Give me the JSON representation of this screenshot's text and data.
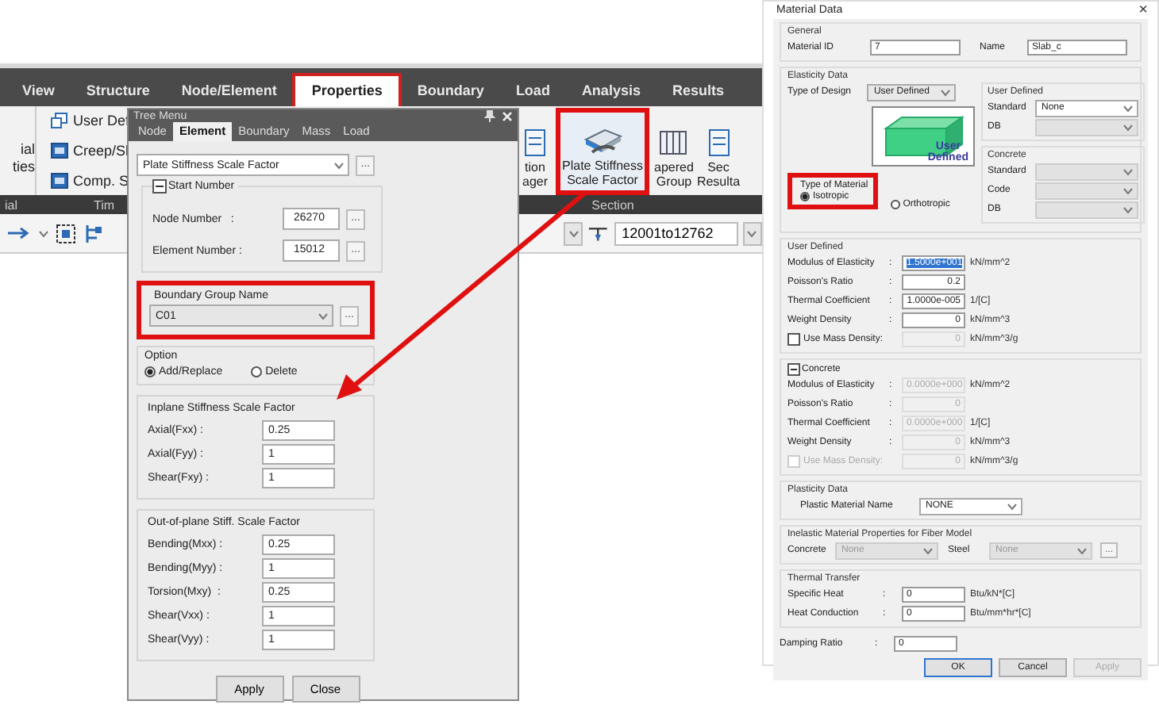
{
  "ribbon": {
    "tabs": [
      {
        "label": "View",
        "selected": false
      },
      {
        "label": "Structure",
        "selected": false
      },
      {
        "label": "Node/Element",
        "selected": false
      },
      {
        "label": "Properties",
        "selected": true
      },
      {
        "label": "Boundary",
        "selected": false
      },
      {
        "label": "Load",
        "selected": false
      },
      {
        "label": "Analysis",
        "selected": false
      },
      {
        "label": "Results",
        "selected": false
      }
    ],
    "left_large": "ial\nties",
    "left_small": [
      "User Def",
      "Creep/Sl",
      "Comp. S"
    ],
    "right_buttons": [
      {
        "label": "tion\nager",
        "highlighted": false
      },
      {
        "label": "Plate Stiffness\nScale Factor",
        "highlighted": true
      },
      {
        "label": "apered\nGroup",
        "highlighted": false
      },
      {
        "label": "Sec\nResulta",
        "highlighted": false
      }
    ],
    "group_labels_left": [
      "ial",
      "Tim"
    ],
    "group_label_right": "Section"
  },
  "toolbar": {
    "range": "12001to12762"
  },
  "tree_menu": {
    "title": "Tree Menu",
    "tabs": [
      {
        "label": "Node",
        "selected": false
      },
      {
        "label": "Element",
        "selected": true
      },
      {
        "label": "Boundary",
        "selected": false
      },
      {
        "label": "Mass",
        "selected": false
      },
      {
        "label": "Load",
        "selected": false
      }
    ],
    "function": "Plate Stiffness Scale Factor",
    "browse": "...",
    "start_number": {
      "title": "Start Number",
      "fields": [
        {
          "label": "Node Number   :",
          "value": "26270"
        },
        {
          "label": "Element Number :",
          "value": "15012"
        }
      ]
    },
    "boundary_group": {
      "label": "Boundary Group Name",
      "value": "C01",
      "highlighted": true
    },
    "option": {
      "title": "Option",
      "choices": [
        {
          "label": "Add/Replace",
          "selected": true
        },
        {
          "label": "Delete",
          "selected": false
        }
      ]
    },
    "groups": [
      {
        "title": "Inplane Stiffness Scale Factor",
        "fields": [
          {
            "label": "Axial(Fxx) :",
            "value": "0.25"
          },
          {
            "label": "Axial(Fyy) :",
            "value": "1"
          },
          {
            "label": "Shear(Fxy) :",
            "value": "1"
          }
        ]
      },
      {
        "title": "Out-of-plane Stiff. Scale Factor",
        "fields": [
          {
            "label": "Bending(Mxx) :",
            "value": "0.25"
          },
          {
            "label": "Bending(Myy) :",
            "value": "1"
          },
          {
            "label": "Torsion(Mxy)  :",
            "value": "0.25"
          },
          {
            "label": "Shear(Vxx) :",
            "value": "1"
          },
          {
            "label": "Shear(Vyy) :",
            "value": "1"
          }
        ]
      }
    ],
    "buttons": [
      "Apply",
      "Close"
    ]
  },
  "material_data": {
    "title": "Material Data",
    "close": "×",
    "general": {
      "title": "General",
      "id_label": "Material ID",
      "id": "7",
      "name_label": "Name",
      "name": "Slab_c"
    },
    "elasticity": {
      "title": "Elasticity Data",
      "design_label": "Type of Design",
      "design": "User Defined",
      "preview_caption": "User\nDefined",
      "material_type": {
        "title": "Type of Material",
        "highlighted": true,
        "choices": [
          {
            "label": "Isotropic",
            "selected": true
          },
          {
            "label": "Orthotropic",
            "selected": false
          }
        ]
      },
      "user_defined_std": {
        "title": "User Defined",
        "rows": [
          {
            "label": "Standard",
            "value": "None",
            "disabled": false
          },
          {
            "label": "DB",
            "disabled": true
          }
        ]
      },
      "concrete_std": {
        "title": "Concrete",
        "rows": [
          {
            "label": "Standard",
            "disabled": true
          },
          {
            "label": "Code",
            "disabled": true
          },
          {
            "label": "DB",
            "disabled": true
          }
        ]
      }
    },
    "user_defined": {
      "title": "User Defined",
      "rows": [
        {
          "kind": "field",
          "label": "Modulus of Elasticity",
          "sep": ":",
          "value": "1.5000e+001",
          "unit": "kN/mm^2",
          "selected": true
        },
        {
          "kind": "field",
          "label": "Poisson's Ratio",
          "sep": ":",
          "value": "0.2",
          "selected": false
        },
        {
          "kind": "field",
          "label": "Thermal Coefficient",
          "sep": ":",
          "value": "1.0000e-005",
          "unit": "1/[C]",
          "selected": false
        },
        {
          "kind": "field",
          "label": "Weight Density",
          "sep": ":",
          "value": "0",
          "unit": "kN/mm^3",
          "selected": false
        },
        {
          "kind": "check",
          "label": "Use Mass Density:",
          "checked": false,
          "value": "0",
          "unit": "kN/mm^3/g",
          "selected": false
        }
      ]
    },
    "concrete": {
      "title": "Concrete",
      "disabled": true,
      "rows": [
        {
          "kind": "field",
          "label": "Modulus of Elasticity",
          "sep": ":",
          "value": "0.0000e+000",
          "unit": "kN/mm^2",
          "selected": false
        },
        {
          "kind": "field",
          "label": "Poisson's Ratio",
          "sep": ":",
          "value": "0",
          "selected": false
        },
        {
          "kind": "field",
          "label": "Thermal Coefficient",
          "sep": ":",
          "value": "0.0000e+000",
          "unit": "1/[C]",
          "selected": false
        },
        {
          "kind": "field",
          "label": "Weight Density",
          "sep": ":",
          "value": "0",
          "unit": "kN/mm^3",
          "selected": false
        },
        {
          "kind": "check",
          "label": "Use Mass Density:",
          "checked": false,
          "value": "0",
          "unit": "kN/mm^3/g",
          "selected": false
        }
      ]
    },
    "plasticity": {
      "title": "Plasticity Data",
      "label": "Plastic Material Name",
      "value": "NONE"
    },
    "inelastic": {
      "title": "Inelastic Material Properties for Fiber Model",
      "concrete_label": "Concrete",
      "concrete": "None",
      "steel_label": "Steel",
      "steel": "None",
      "browse": "..."
    },
    "thermal": {
      "title": "Thermal Transfer",
      "rows": [
        {
          "label": "Specific Heat",
          "sep": ":",
          "value": "0",
          "unit": "Btu/kN*[C]"
        },
        {
          "label": "Heat Conduction",
          "sep": ":",
          "value": "0",
          "unit": "Btu/mm*hr*[C]"
        }
      ]
    },
    "damping": {
      "label": "Damping Ratio",
      "sep": ":",
      "value": "0"
    },
    "buttons": [
      {
        "label": "OK",
        "disabled": false,
        "default": true
      },
      {
        "label": "Cancel",
        "disabled": false,
        "default": false
      },
      {
        "label": "Apply",
        "disabled": true,
        "default": false
      }
    ]
  },
  "annotation_arrow": true
}
